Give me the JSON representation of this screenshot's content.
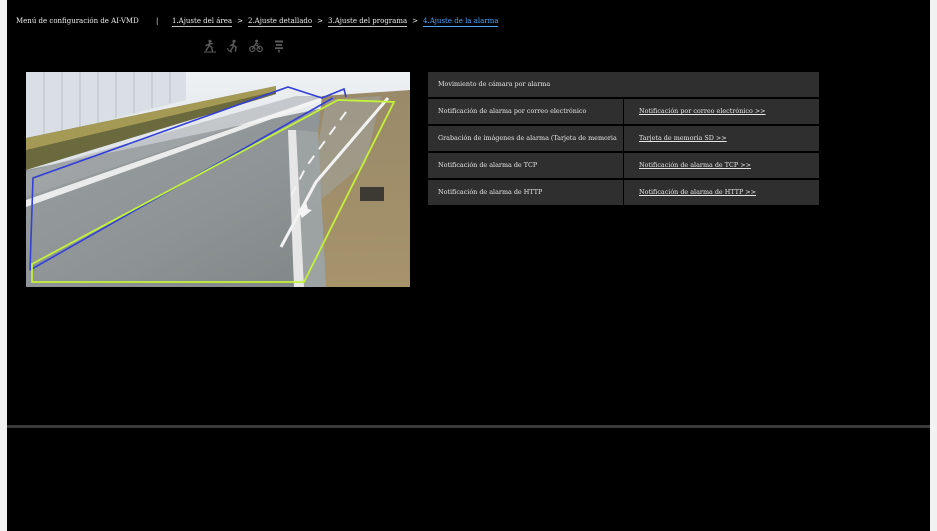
{
  "header": {
    "app_title": "Menú de configuración de AI-VMD",
    "separator": "|",
    "breadcrumbs": [
      {
        "label": "1.Ajuste del área",
        "active": false
      },
      {
        "label": "2.Ajuste detallado",
        "active": false
      },
      {
        "label": "3.Ajuste del programa",
        "active": false
      },
      {
        "label": "4.Ajuste de la alarma",
        "active": true
      }
    ],
    "arrow": ">"
  },
  "toolbar": {
    "icons": [
      "person-crossing-icon",
      "person-turning-icon",
      "bicycle-icon",
      "filter-icon"
    ]
  },
  "alarm_table": {
    "camera_action": "Movimiento de cámara por alarma",
    "rows": [
      {
        "label": "Notificación de alarma por correo electrónico",
        "link": "Notificación por correo electrónico >>"
      },
      {
        "label": "Grabación de imágenes de alarma (Tarjeta de memoria SD)",
        "link": "Tarjeta de memoria SD >>"
      },
      {
        "label": "Notificación de alarma de TCP",
        "link": "Notificación de alarma de TCP >>"
      },
      {
        "label": "Notificación de alarma de HTTP",
        "link": "Notificación de alarma de HTTP >>"
      }
    ]
  },
  "colors": {
    "active_step": "#4aa3ff",
    "area_blue": "#3340d6",
    "area_yellow": "#c4f238",
    "cell_bg": "#2f2f2f"
  }
}
